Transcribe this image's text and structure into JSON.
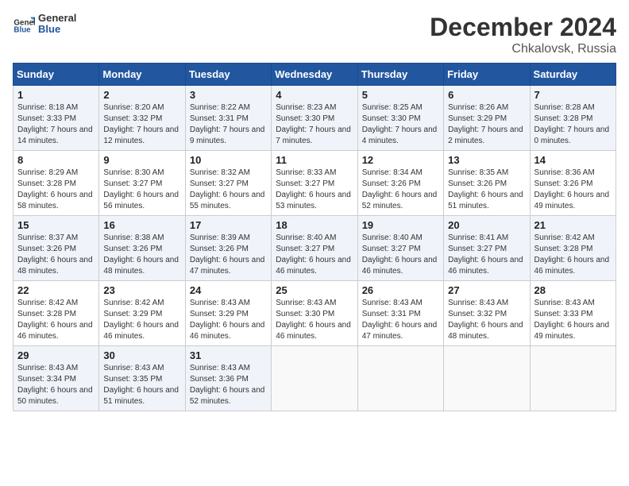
{
  "header": {
    "logo_line1": "General",
    "logo_line2": "Blue",
    "title": "December 2024",
    "subtitle": "Chkalovsk, Russia"
  },
  "columns": [
    "Sunday",
    "Monday",
    "Tuesday",
    "Wednesday",
    "Thursday",
    "Friday",
    "Saturday"
  ],
  "weeks": [
    [
      {
        "day": "1",
        "sunrise": "Sunrise: 8:18 AM",
        "sunset": "Sunset: 3:33 PM",
        "daylight": "Daylight: 7 hours and 14 minutes."
      },
      {
        "day": "2",
        "sunrise": "Sunrise: 8:20 AM",
        "sunset": "Sunset: 3:32 PM",
        "daylight": "Daylight: 7 hours and 12 minutes."
      },
      {
        "day": "3",
        "sunrise": "Sunrise: 8:22 AM",
        "sunset": "Sunset: 3:31 PM",
        "daylight": "Daylight: 7 hours and 9 minutes."
      },
      {
        "day": "4",
        "sunrise": "Sunrise: 8:23 AM",
        "sunset": "Sunset: 3:30 PM",
        "daylight": "Daylight: 7 hours and 7 minutes."
      },
      {
        "day": "5",
        "sunrise": "Sunrise: 8:25 AM",
        "sunset": "Sunset: 3:30 PM",
        "daylight": "Daylight: 7 hours and 4 minutes."
      },
      {
        "day": "6",
        "sunrise": "Sunrise: 8:26 AM",
        "sunset": "Sunset: 3:29 PM",
        "daylight": "Daylight: 7 hours and 2 minutes."
      },
      {
        "day": "7",
        "sunrise": "Sunrise: 8:28 AM",
        "sunset": "Sunset: 3:28 PM",
        "daylight": "Daylight: 7 hours and 0 minutes."
      }
    ],
    [
      {
        "day": "8",
        "sunrise": "Sunrise: 8:29 AM",
        "sunset": "Sunset: 3:28 PM",
        "daylight": "Daylight: 6 hours and 58 minutes."
      },
      {
        "day": "9",
        "sunrise": "Sunrise: 8:30 AM",
        "sunset": "Sunset: 3:27 PM",
        "daylight": "Daylight: 6 hours and 56 minutes."
      },
      {
        "day": "10",
        "sunrise": "Sunrise: 8:32 AM",
        "sunset": "Sunset: 3:27 PM",
        "daylight": "Daylight: 6 hours and 55 minutes."
      },
      {
        "day": "11",
        "sunrise": "Sunrise: 8:33 AM",
        "sunset": "Sunset: 3:27 PM",
        "daylight": "Daylight: 6 hours and 53 minutes."
      },
      {
        "day": "12",
        "sunrise": "Sunrise: 8:34 AM",
        "sunset": "Sunset: 3:26 PM",
        "daylight": "Daylight: 6 hours and 52 minutes."
      },
      {
        "day": "13",
        "sunrise": "Sunrise: 8:35 AM",
        "sunset": "Sunset: 3:26 PM",
        "daylight": "Daylight: 6 hours and 51 minutes."
      },
      {
        "day": "14",
        "sunrise": "Sunrise: 8:36 AM",
        "sunset": "Sunset: 3:26 PM",
        "daylight": "Daylight: 6 hours and 49 minutes."
      }
    ],
    [
      {
        "day": "15",
        "sunrise": "Sunrise: 8:37 AM",
        "sunset": "Sunset: 3:26 PM",
        "daylight": "Daylight: 6 hours and 48 minutes."
      },
      {
        "day": "16",
        "sunrise": "Sunrise: 8:38 AM",
        "sunset": "Sunset: 3:26 PM",
        "daylight": "Daylight: 6 hours and 48 minutes."
      },
      {
        "day": "17",
        "sunrise": "Sunrise: 8:39 AM",
        "sunset": "Sunset: 3:26 PM",
        "daylight": "Daylight: 6 hours and 47 minutes."
      },
      {
        "day": "18",
        "sunrise": "Sunrise: 8:40 AM",
        "sunset": "Sunset: 3:27 PM",
        "daylight": "Daylight: 6 hours and 46 minutes."
      },
      {
        "day": "19",
        "sunrise": "Sunrise: 8:40 AM",
        "sunset": "Sunset: 3:27 PM",
        "daylight": "Daylight: 6 hours and 46 minutes."
      },
      {
        "day": "20",
        "sunrise": "Sunrise: 8:41 AM",
        "sunset": "Sunset: 3:27 PM",
        "daylight": "Daylight: 6 hours and 46 minutes."
      },
      {
        "day": "21",
        "sunrise": "Sunrise: 8:42 AM",
        "sunset": "Sunset: 3:28 PM",
        "daylight": "Daylight: 6 hours and 46 minutes."
      }
    ],
    [
      {
        "day": "22",
        "sunrise": "Sunrise: 8:42 AM",
        "sunset": "Sunset: 3:28 PM",
        "daylight": "Daylight: 6 hours and 46 minutes."
      },
      {
        "day": "23",
        "sunrise": "Sunrise: 8:42 AM",
        "sunset": "Sunset: 3:29 PM",
        "daylight": "Daylight: 6 hours and 46 minutes."
      },
      {
        "day": "24",
        "sunrise": "Sunrise: 8:43 AM",
        "sunset": "Sunset: 3:29 PM",
        "daylight": "Daylight: 6 hours and 46 minutes."
      },
      {
        "day": "25",
        "sunrise": "Sunrise: 8:43 AM",
        "sunset": "Sunset: 3:30 PM",
        "daylight": "Daylight: 6 hours and 46 minutes."
      },
      {
        "day": "26",
        "sunrise": "Sunrise: 8:43 AM",
        "sunset": "Sunset: 3:31 PM",
        "daylight": "Daylight: 6 hours and 47 minutes."
      },
      {
        "day": "27",
        "sunrise": "Sunrise: 8:43 AM",
        "sunset": "Sunset: 3:32 PM",
        "daylight": "Daylight: 6 hours and 48 minutes."
      },
      {
        "day": "28",
        "sunrise": "Sunrise: 8:43 AM",
        "sunset": "Sunset: 3:33 PM",
        "daylight": "Daylight: 6 hours and 49 minutes."
      }
    ],
    [
      {
        "day": "29",
        "sunrise": "Sunrise: 8:43 AM",
        "sunset": "Sunset: 3:34 PM",
        "daylight": "Daylight: 6 hours and 50 minutes."
      },
      {
        "day": "30",
        "sunrise": "Sunrise: 8:43 AM",
        "sunset": "Sunset: 3:35 PM",
        "daylight": "Daylight: 6 hours and 51 minutes."
      },
      {
        "day": "31",
        "sunrise": "Sunrise: 8:43 AM",
        "sunset": "Sunset: 3:36 PM",
        "daylight": "Daylight: 6 hours and 52 minutes."
      },
      null,
      null,
      null,
      null
    ]
  ]
}
